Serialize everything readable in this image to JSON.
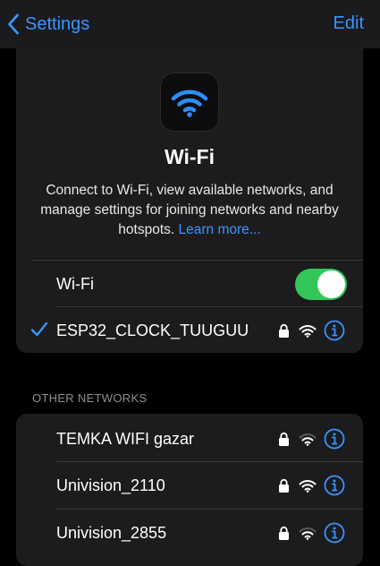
{
  "nav": {
    "back_label": "Settings",
    "edit_label": "Edit"
  },
  "hero": {
    "title": "Wi-Fi",
    "description": "Connect to Wi-Fi, view available networks, and manage settings for joining networks and nearby hotspots.",
    "learn_more": "Learn more..."
  },
  "wifi_toggle": {
    "label": "Wi-Fi",
    "state": "on"
  },
  "connected_network": {
    "name": "ESP32_CLOCK_TUUGUU",
    "secured": true,
    "selected": true
  },
  "other_networks": {
    "header": "OTHER NETWORKS",
    "items": [
      {
        "name": "TEMKA WIFI gazar",
        "secured": true
      },
      {
        "name": "Univision_2110",
        "secured": true
      },
      {
        "name": "Univision_2855",
        "secured": true
      }
    ]
  },
  "colors": {
    "accent": "#3a95ff",
    "toggle_on": "#33c75a",
    "card_bg": "#1c1c1e",
    "page_bg": "#000000"
  },
  "icons": {
    "back": "chevron-left-icon",
    "app": "wifi-icon",
    "check": "checkmark-icon",
    "lock": "lock-icon",
    "signal": "wifi-signal-icon",
    "info": "info-icon"
  }
}
